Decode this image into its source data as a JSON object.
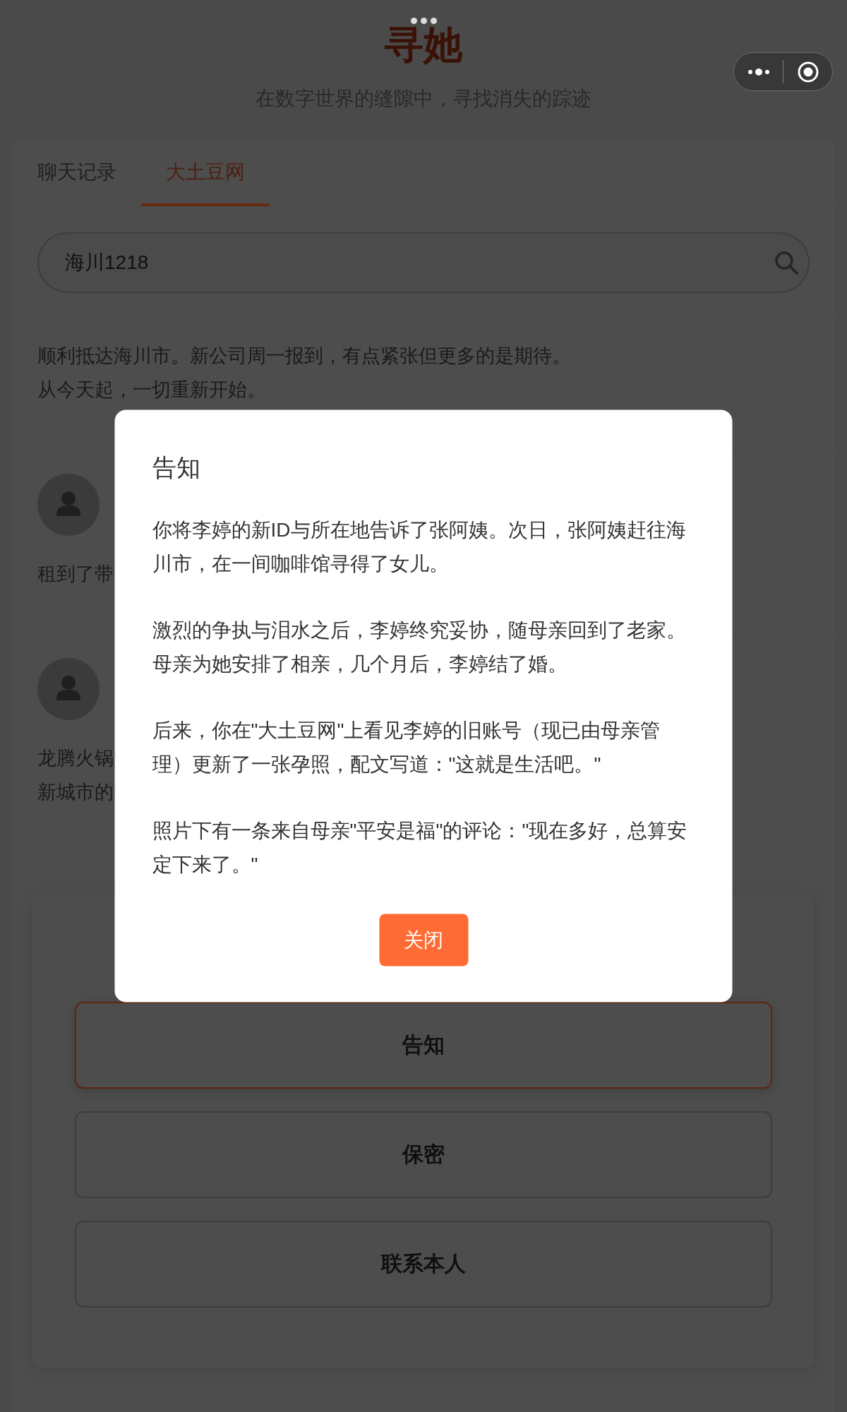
{
  "header": {
    "title": "寻她",
    "subtitle": "在数字世界的缝隙中，寻找消失的踪迹"
  },
  "tabs": [
    {
      "label": "聊天记录",
      "selected": false
    },
    {
      "label": "大土豆网",
      "selected": true
    }
  ],
  "search": {
    "value": "海川1218"
  },
  "posts": [
    {
      "avatar": false,
      "lines": [
        "顺利抵达海川市。新公司周一报到，有点紧张但更多的是期待。",
        "从今天起，一切重新开始。"
      ]
    },
    {
      "avatar": true,
      "lines": [
        "租到了带"
      ]
    },
    {
      "avatar": true,
      "lines": [
        "龙腾火锅",
        "新城市的"
      ]
    }
  ],
  "choices": [
    {
      "label": "告知",
      "selected": true
    },
    {
      "label": "保密",
      "selected": false
    },
    {
      "label": "联系本人",
      "selected": false
    }
  ],
  "modal": {
    "title": "告知",
    "paragraphs": [
      "你将李婷的新ID与所在地告诉了张阿姨。次日，张阿姨赶往海川市，在一间咖啡馆寻得了女儿。",
      "激烈的争执与泪水之后，李婷终究妥协，随母亲回到了老家。母亲为她安排了相亲，几个月后，李婷结了婚。",
      "后来，你在\"大土豆网\"上看见李婷的旧账号（现已由母亲管理）更新了一张孕照，配文写道：\"这就是生活吧。\"",
      "照片下有一条来自母亲\"平安是福\"的评论：\"现在多好，总算安定下来了。\""
    ],
    "button": "关闭"
  }
}
